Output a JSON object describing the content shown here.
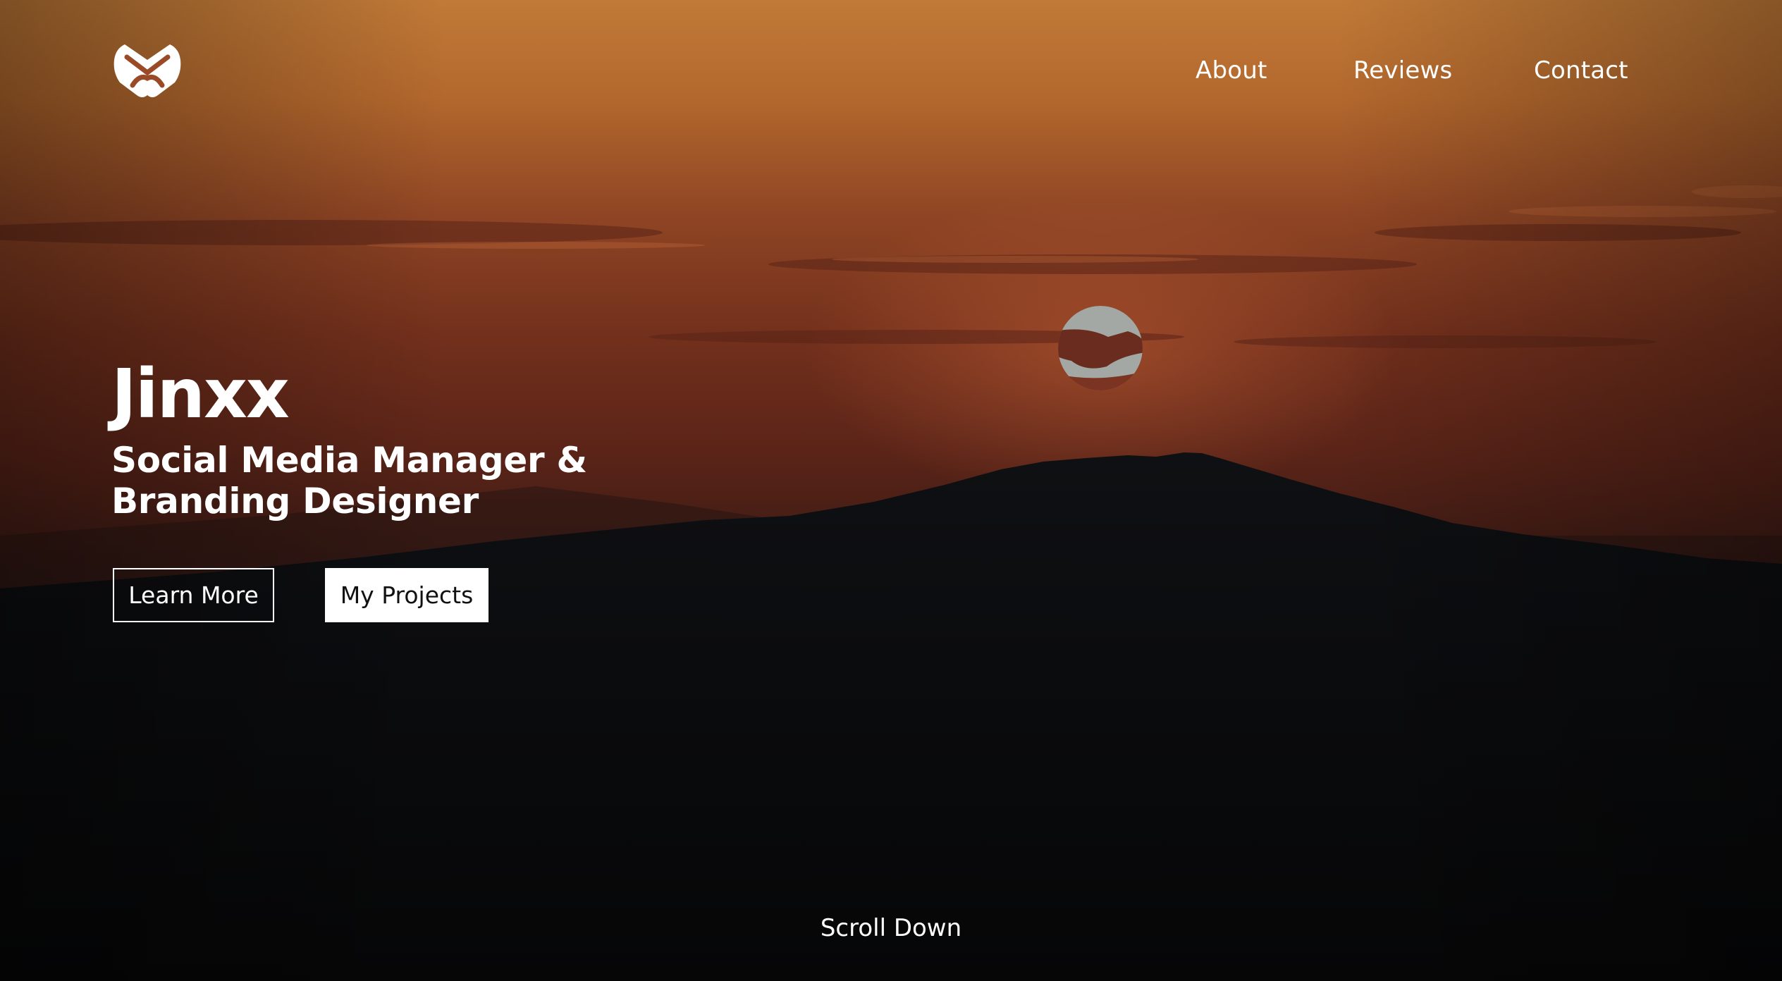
{
  "brand": {
    "logo_icon": "interlocking-v-monogram-logo"
  },
  "nav": {
    "items": [
      {
        "label": "About"
      },
      {
        "label": "Reviews"
      },
      {
        "label": "Contact"
      }
    ]
  },
  "hero": {
    "background": "sunset-over-mountain-photo",
    "title": "Jinxx",
    "subtitle": "Social Media Manager & Branding Designer",
    "buttons": {
      "primary_label": "Learn More",
      "secondary_label": "My Projects"
    },
    "scroll_label": "Scroll Down"
  },
  "colors": {
    "text": "#ffffff",
    "sky_top": "#c17a37",
    "sky_mid": "#7a301c",
    "mountain": "#0c0d10",
    "button_fill": "#ffffff",
    "button_text": "#111111"
  }
}
